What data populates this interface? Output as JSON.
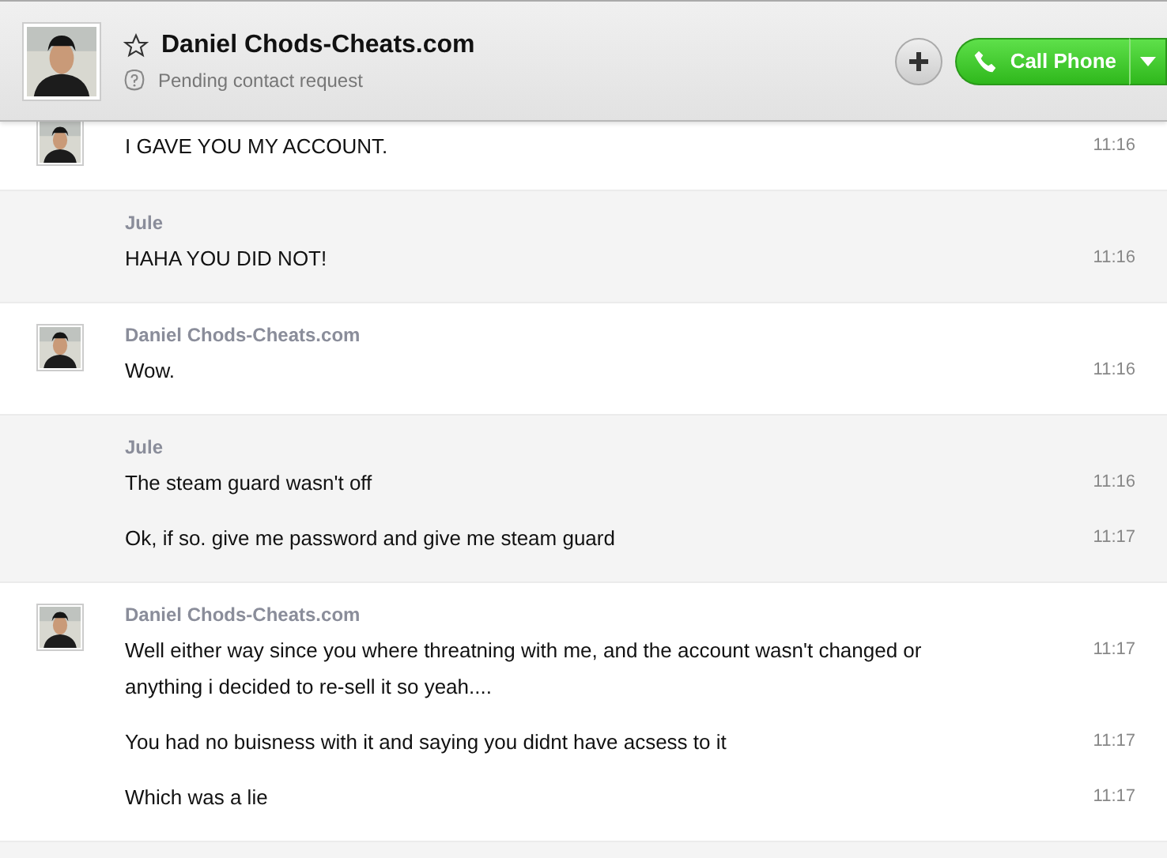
{
  "header": {
    "name": "Daniel Chods-Cheats.com",
    "starred": false,
    "status": "Pending contact request",
    "call_button": "Call Phone"
  },
  "groups": [
    {
      "kind": "contact",
      "messages": [
        {
          "text": "I GAVE YOU MY ACCOUNT.",
          "time": "11:16"
        }
      ]
    },
    {
      "kind": "self",
      "sender": "Jule",
      "messages": [
        {
          "text": "HAHA YOU DID NOT!",
          "time": "11:16"
        }
      ]
    },
    {
      "kind": "contact",
      "sender": "Daniel Chods-Cheats.com",
      "messages": [
        {
          "text": "Wow.",
          "time": "11:16"
        }
      ]
    },
    {
      "kind": "self",
      "sender": "Jule",
      "messages": [
        {
          "text": "The steam guard wasn't off",
          "time": "11:16"
        },
        {
          "text": "Ok, if so. give me password and give me steam guard",
          "time": "11:17"
        }
      ]
    },
    {
      "kind": "contact",
      "sender": "Daniel Chods-Cheats.com",
      "messages": [
        {
          "text": "Well either way since you where threatning with me, and the account wasn't changed or anything i decided to re-sell it so yeah....",
          "time": "11:17"
        },
        {
          "text": "You had no buisness with it and saying you didnt have acsess to it",
          "time": "11:17"
        },
        {
          "text": "Which was a lie",
          "time": "11:17"
        }
      ]
    },
    {
      "kind": "self"
    }
  ]
}
